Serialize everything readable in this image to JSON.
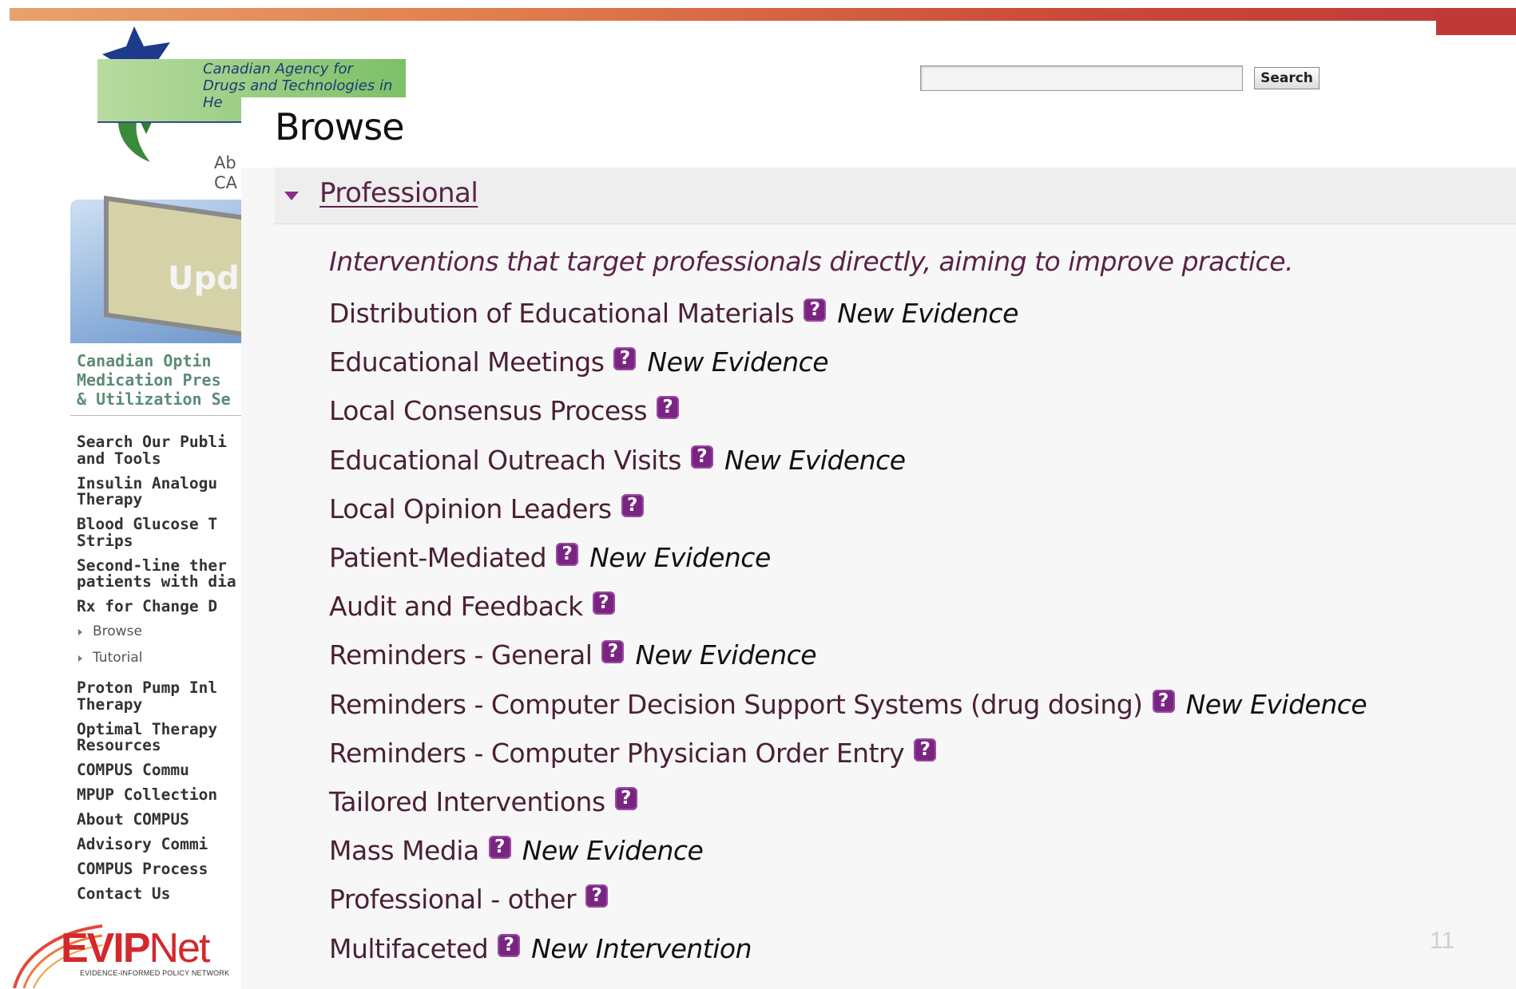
{
  "slide": {
    "page_number": "11"
  },
  "site": {
    "logo_text": "Canadian Agency for Drugs and Technologies in He",
    "about_link": "Ab CA",
    "promo_text": "Upd",
    "promo_caption": "Canadian Optin\nMedication Pres\n& Utilization Se",
    "nav": [
      "Search Our Publi\nand Tools",
      "Insulin Analogu\nTherapy",
      "Blood Glucose T\nStrips",
      "Second-line ther\npatients with dia",
      "Rx for Change D"
    ],
    "nav_sub": [
      "Browse",
      "Tutorial"
    ],
    "nav_more": [
      "Proton Pump Inl\nTherapy",
      "Optimal Therapy\nResources",
      "COMPUS Commu",
      "MPUP Collection",
      "About COMPUS",
      "Advisory Commi",
      "COMPUS Process",
      "Contact Us"
    ],
    "search": {
      "value": "",
      "button": "Search"
    },
    "footer_logo": {
      "word_ev": "EVIP",
      "word_net": "Net",
      "tagline": "EVIDENCE-INFORMED POLICY NETWORK"
    }
  },
  "panel": {
    "title": "Browse",
    "section": {
      "title": "Professional",
      "description": "Interventions that target professionals directly, aiming to improve practice.",
      "help_glyph": "?",
      "items": [
        {
          "label": "Distribution of Educational Materials",
          "flag": "New Evidence"
        },
        {
          "label": "Educational Meetings",
          "flag": "New Evidence"
        },
        {
          "label": "Local Consensus Process",
          "flag": ""
        },
        {
          "label": "Educational Outreach Visits",
          "flag": "New Evidence"
        },
        {
          "label": "Local Opinion Leaders",
          "flag": ""
        },
        {
          "label": "Patient-Mediated",
          "flag": "New Evidence"
        },
        {
          "label": "Audit and Feedback",
          "flag": ""
        },
        {
          "label": "Reminders - General",
          "flag": "New Evidence"
        },
        {
          "label": "Reminders - Computer Decision Support Systems (drug dosing)",
          "flag": "New Evidence"
        },
        {
          "label": "Reminders - Computer Physician Order Entry",
          "flag": ""
        },
        {
          "label": "Tailored Interventions",
          "flag": ""
        },
        {
          "label": "Mass Media",
          "flag": "New Evidence"
        },
        {
          "label": "Professional - other",
          "flag": ""
        },
        {
          "label": "Multifaceted",
          "flag": "New Intervention"
        }
      ]
    }
  }
}
